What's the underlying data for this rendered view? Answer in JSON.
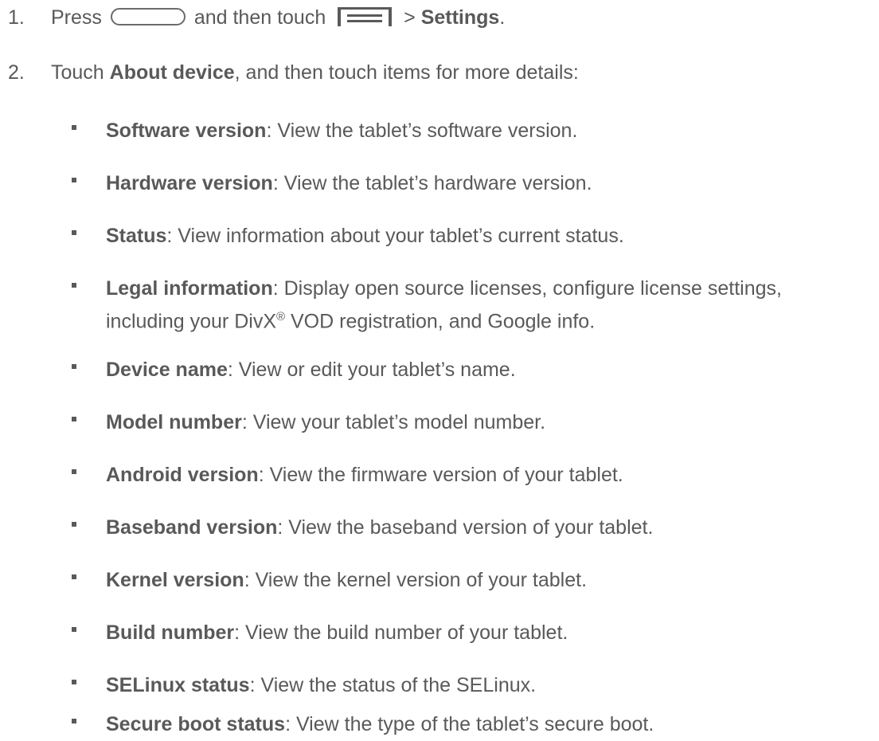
{
  "steps": [
    {
      "number": "1.",
      "prefix": "Press",
      "home_key_icon": "home-key-icon",
      "middle": "and then touch",
      "menu_key_icon": "menu-key-icon",
      "separator": ">",
      "bold": "Settings",
      "suffix": "."
    },
    {
      "number": "2.",
      "prefix": "Touch",
      "bold": "About device",
      "suffix": ", and then touch items for more details:"
    }
  ],
  "items": [
    {
      "term": "Software version",
      "desc": ": View the tablet’s software version."
    },
    {
      "term": "Hardware version",
      "desc": ": View the tablet’s hardware version."
    },
    {
      "term": "Status",
      "desc": ": View information about your tablet’s current status."
    },
    {
      "term": "Legal information",
      "desc": ": Display open source licenses, configure license settings,",
      "line2_a": "including your DivX",
      "line2_sup": "®",
      "line2_b": " VOD registration, and Google info."
    },
    {
      "term": "Device name",
      "desc": ": View or edit your tablet’s name."
    },
    {
      "term": "Model number",
      "desc": ": View your tablet’s model number."
    },
    {
      "term": "Android version",
      "desc": ": View the firmware version of your tablet."
    },
    {
      "term": "Baseband version",
      "desc": ": View the baseband version of your tablet."
    },
    {
      "term": "Kernel version",
      "desc": ": View the kernel version of your tablet."
    },
    {
      "term": "Build number",
      "desc": ": View the build number of your tablet."
    },
    {
      "term": "SELinux status",
      "desc": ": View the status of the SELinux."
    },
    {
      "term": "Secure boot status",
      "desc": ": View the type of the tablet’s secure boot."
    }
  ]
}
